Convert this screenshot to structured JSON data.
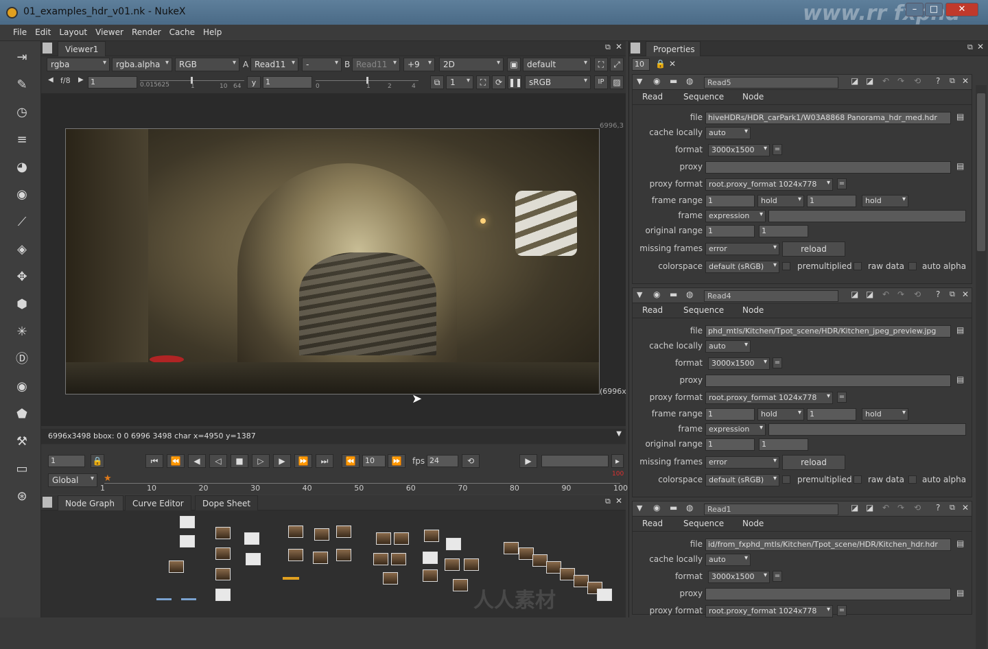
{
  "window": {
    "title": "01_examples_hdr_v01.nk - NukeX",
    "watermark": "www.rr fxphd"
  },
  "menu": [
    "File",
    "Edit",
    "Layout",
    "Viewer",
    "Render",
    "Cache",
    "Help"
  ],
  "left_toolbar_icons": [
    "transfer-icon",
    "paint-icon",
    "time-icon",
    "channel-icon",
    "color-icon",
    "filter-icon",
    "keyer-icon",
    "merge-icon",
    "transform-icon",
    "3d-icon",
    "particles-icon",
    "deep-icon",
    "views-icon",
    "metadata-icon",
    "toolsets-icon",
    "other-icon",
    "nukex-icon"
  ],
  "viewer": {
    "tab": "Viewer1",
    "layer": "rgba",
    "alpha": "rgba.alpha",
    "display": "RGB",
    "a_label": "A",
    "a_input": "Read11",
    "compare": "-",
    "b_label": "B",
    "b_input": "Read11",
    "gain_op": "+9",
    "view_mode": "2D",
    "lut_default": "default",
    "fstop": "f/8",
    "gain_value": "1",
    "gain_scale": "0.015625",
    "gain_marks": [
      "1",
      "10",
      "64"
    ],
    "y_label": "y",
    "gamma_value": "1",
    "gamma_marks": [
      "0",
      "1",
      "2",
      "4"
    ],
    "proxy_scale": "1",
    "colorspace": "sRGB",
    "format_top": "6996,3",
    "format_bottom": "(6996x",
    "status": "6996x3498 bbox: 0 0 6996 3498 char  x=4950 y=1387"
  },
  "timeline": {
    "frame": "1",
    "step": "10",
    "fps_label": "fps",
    "fps": "24",
    "range_mode": "Global",
    "end_marker": "100",
    "ticks": [
      "1",
      "10",
      "20",
      "30",
      "40",
      "50",
      "60",
      "70",
      "80",
      "90",
      "100"
    ]
  },
  "nodegraph": {
    "tabs": [
      "Node Graph",
      "Curve Editor",
      "Dope Sheet"
    ],
    "watermark": "人人素材"
  },
  "properties": {
    "tab": "Properties",
    "max_panels": "10",
    "panels": [
      {
        "name": "Read5",
        "tabs": [
          "Read",
          "Sequence",
          "Node"
        ],
        "file": "hiveHDRs/HDR_carPark1/W03A8868 Panorama_hdr_med.hdr",
        "cache": "auto",
        "format": "3000x1500",
        "proxy": "",
        "proxy_format": "root.proxy_format 1024x778",
        "first": "1",
        "before": "hold",
        "last": "1",
        "after": "hold",
        "frame_mode": "expression",
        "orig_first": "1",
        "orig_last": "1",
        "missing": "error",
        "reload": "reload",
        "colorspace": "default (sRGB)",
        "premult": "premultiplied",
        "raw": "raw data",
        "auto_alpha": "auto alpha"
      },
      {
        "name": "Read4",
        "tabs": [
          "Read",
          "Sequence",
          "Node"
        ],
        "file": "phd_mtls/Kitchen/Tpot_scene/HDR/Kitchen_jpeg_preview.jpg",
        "cache": "auto",
        "format": "3000x1500",
        "proxy": "",
        "proxy_format": "root.proxy_format 1024x778",
        "first": "1",
        "before": "hold",
        "last": "1",
        "after": "hold",
        "frame_mode": "expression",
        "orig_first": "1",
        "orig_last": "1",
        "missing": "error",
        "reload": "reload",
        "colorspace": "default (sRGB)",
        "premult": "premultiplied",
        "raw": "raw data",
        "auto_alpha": "auto alpha"
      },
      {
        "name": "Read1",
        "tabs": [
          "Read",
          "Sequence",
          "Node"
        ],
        "file": "id/from_fxphd_mtls/Kitchen/Tpot_scene/HDR/Kitchen_hdr.hdr",
        "cache": "auto",
        "format": "3000x1500",
        "proxy": "",
        "proxy_format": "root.proxy_format 1024x778"
      }
    ],
    "labels": {
      "file": "file",
      "cache": "cache locally",
      "format": "format",
      "proxy": "proxy",
      "proxy_format": "proxy format",
      "frame_range": "frame range",
      "frame": "frame",
      "original_range": "original range",
      "missing_frames": "missing frames",
      "colorspace": "colorspace"
    }
  }
}
